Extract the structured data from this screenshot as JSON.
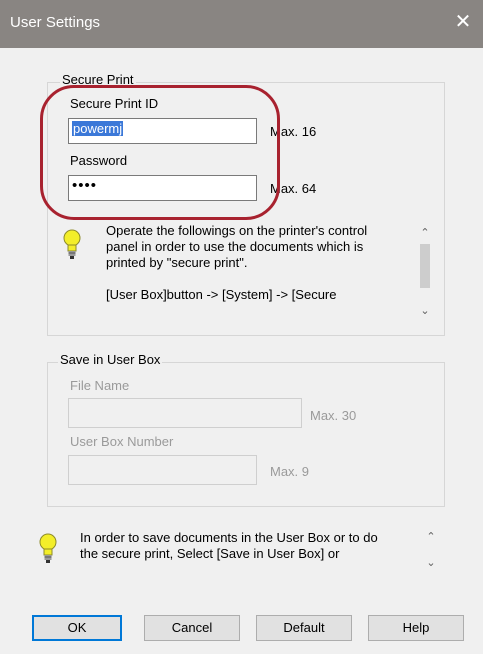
{
  "window": {
    "title": "User Settings"
  },
  "secure_print": {
    "group_label": "Secure Print",
    "id_label": "Secure Print ID",
    "id_value": "powermj",
    "id_max": "Max. 16",
    "password_label": "Password",
    "password_value": "••••",
    "password_max": "Max. 64",
    "info_line1": "Operate the followings on the printer's control",
    "info_line2": "panel in order to use the documents which is",
    "info_line3": "printed by \"secure print\".",
    "info_line4": "[User Box]button -> [System] -> [Secure"
  },
  "save_user_box": {
    "group_label": "Save in User Box",
    "file_name_label": "File Name",
    "file_name_max": "Max. 30",
    "box_number_label": "User Box Number",
    "box_number_max": "Max. 9"
  },
  "bottom_info": {
    "line1": "In order to save documents in the User Box or to do",
    "line2": "the secure print, Select [Save in User Box] or"
  },
  "buttons": {
    "ok": "OK",
    "cancel": "Cancel",
    "default": "Default",
    "help": "Help"
  },
  "colors": {
    "titlebar": "#898582",
    "highlight_oval": "#a8222f",
    "selection": "#3b78d8"
  }
}
